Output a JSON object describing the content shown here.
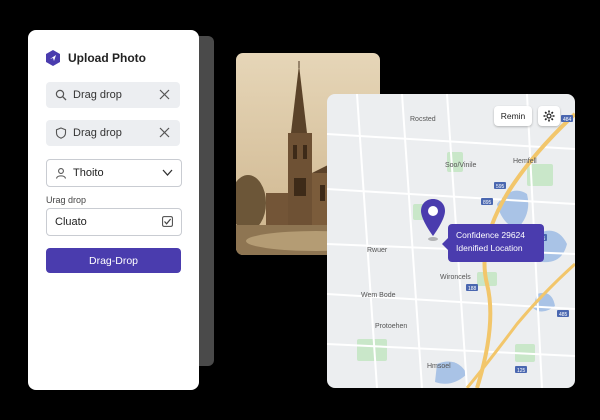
{
  "upload_panel": {
    "title": "Upload Photo",
    "field1_text": "Drag drop",
    "field2_text": "Drag drop",
    "select_value": "Thoito",
    "small_label": "Urag drop",
    "check_field_text": "Cluato",
    "primary_button": "Drag-Drop"
  },
  "map": {
    "remin_button": "Remin",
    "labels": [
      "Rocsted",
      "Soo/Vinile",
      "Hemfell",
      "Wem Bode",
      "Protoehen",
      "Hmsoel",
      "Wironcels",
      "Rwuer"
    ],
    "road_badges": [
      "484",
      "595",
      "895",
      "825",
      "188",
      "485",
      "125"
    ],
    "tooltip": {
      "line1": "Confidence 29624",
      "line2": "Idenified Location"
    }
  },
  "colors": {
    "accent": "#4a3cae",
    "map_background": "#eceef0",
    "water": "#a9c3e6",
    "park": "#c9e7c9",
    "highway": "#f2c66b"
  }
}
